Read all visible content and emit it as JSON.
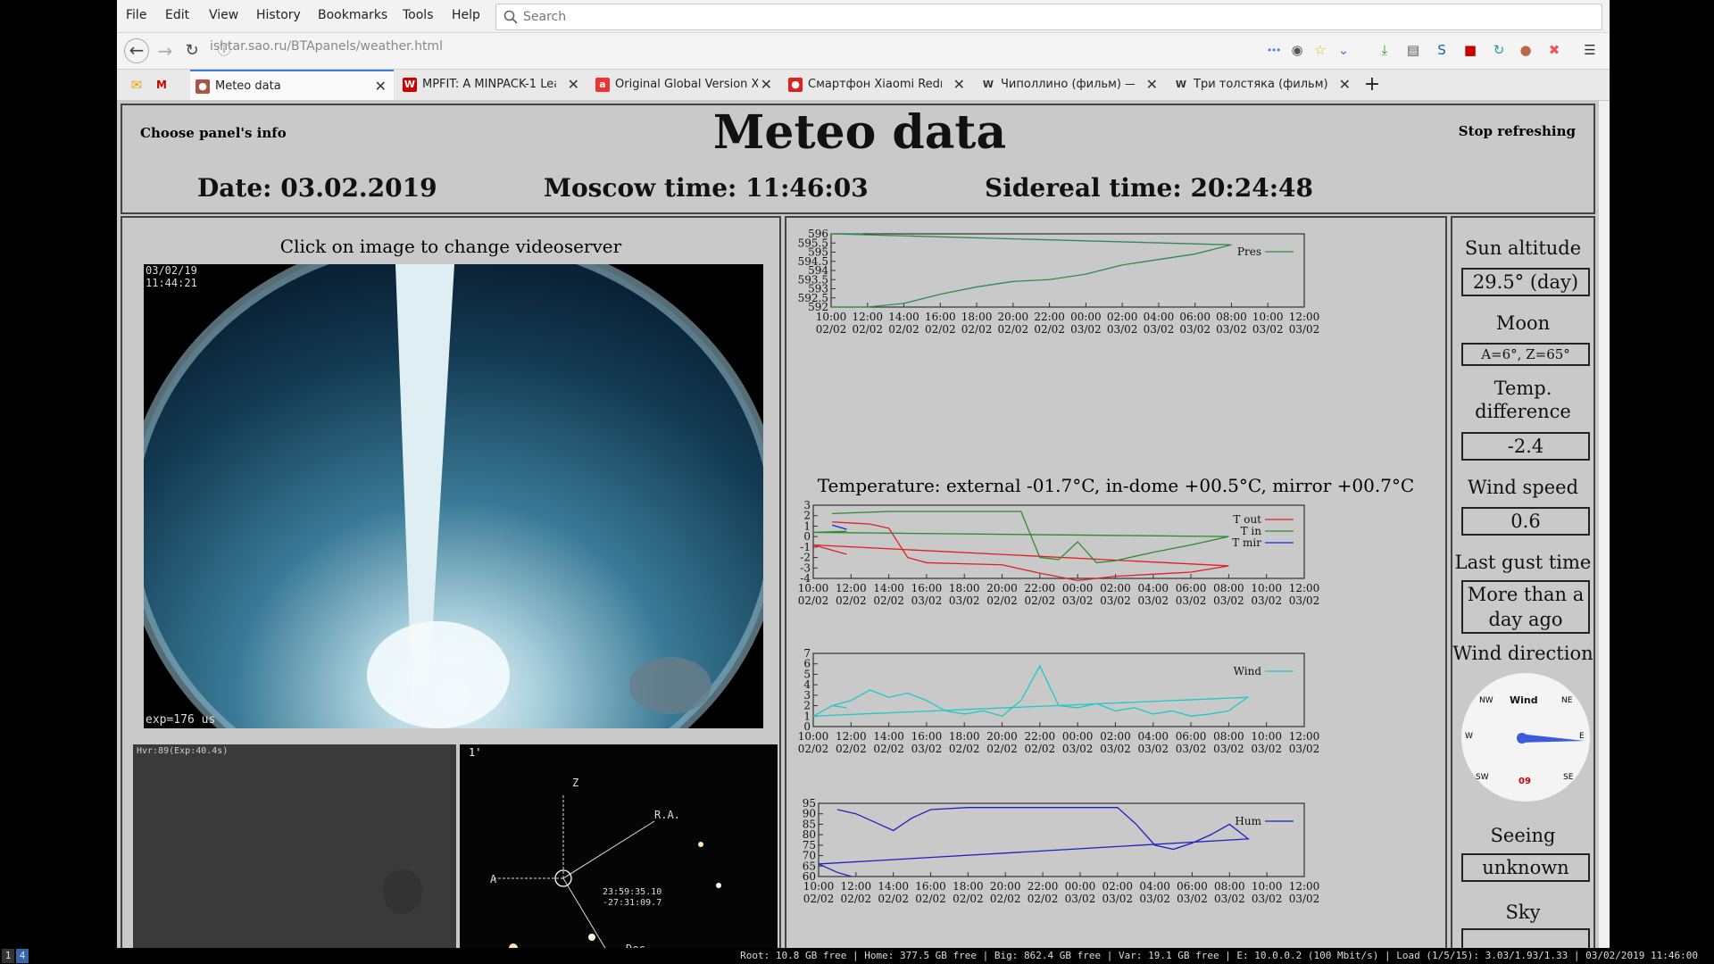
{
  "menu": {
    "items": [
      "File",
      "Edit",
      "View",
      "History",
      "Bookmarks",
      "Tools",
      "Help"
    ],
    "search_placeholder": "Search"
  },
  "nav": {
    "url": "ishtar.sao.ru/BTApanels/weather.html"
  },
  "tabs": [
    {
      "label": "Meteo data",
      "active": true,
      "fav_color": "#a54"
    },
    {
      "label": "MPFIT: A MINPACK-1 Lea",
      "fav_color": "#c00"
    },
    {
      "label": "Original Global Version X",
      "fav_color": "#e33"
    },
    {
      "label": "Смартфон Xiaomi Redm",
      "fav_color": "#d22"
    },
    {
      "label": "Чиполлино (фильм) —",
      "fav_color": "#555"
    },
    {
      "label": "Три толстяка (фильм) .",
      "fav_color": "#555"
    }
  ],
  "page": {
    "title": "Meteo data",
    "choose_panels": "Choose panel's info",
    "stop_refreshing": "Stop refreshing",
    "date": "Date: 03.02.2019",
    "moscow_time": "Moscow time: 11:46:03",
    "sidereal_time": "Sidereal time: 20:24:48",
    "click_hint": "Click on image to change videoserver",
    "cam_date": "03/02/19",
    "cam_time": "11:44:21",
    "cam_exposure": "exp=176 us",
    "cam2_label": "Hvr:89(Exp:40.4s)",
    "cam3_label": "1'",
    "cam3_coord1": "23:59:35.10",
    "cam3_coord2": "-27:31:09.7",
    "cam3_ra": "R.A.",
    "cam3_dec": "Dec",
    "cam3_z": "Z",
    "cam3_a": "A"
  },
  "temp_heading": "Temperature: external -01.7°C, in-dome +00.5°C, mirror +00.7°C",
  "right_panel": {
    "sun_label": "Sun altitude",
    "sun_value": "29.5° (day)",
    "moon_label": "Moon",
    "moon_value": "A=6°, Z=65°",
    "tdiff_label": "Temp. difference",
    "tdiff_value": "-2.4",
    "wind_label": "Wind speed",
    "wind_value": "0.6",
    "gust_label": "Last gust time",
    "gust_value": "More than a day ago",
    "dir_label": "Wind direction",
    "compass": {
      "center": "Wind",
      "nw": "NW",
      "ne": "NE",
      "w": "W",
      "e": "E",
      "sw": "SW",
      "se": "SE",
      "reading": "09"
    },
    "seeing_label": "Seeing",
    "seeing_value": "unknown",
    "sky_label": "Sky"
  },
  "chart_data": [
    {
      "type": "line",
      "title": "",
      "series": [
        {
          "name": "Pres",
          "color": "#2e8b57",
          "x": [
            "10:00",
            "12:00",
            "14:00",
            "16:00",
            "18:00",
            "20:00",
            "22:00",
            "00:00",
            "02:00",
            "04:00",
            "06:00",
            "08:00",
            "10:00",
            "11:46"
          ],
          "values": [
            592,
            592,
            592.2,
            592.7,
            593.1,
            593.4,
            593.5,
            593.8,
            594.3,
            594.6,
            594.9,
            595.4,
            596,
            596
          ]
        }
      ],
      "ylim": [
        592,
        596
      ],
      "yticks": [
        "592",
        "592.5",
        "593",
        "593.5",
        "594",
        "594.5",
        "595",
        "595.5",
        "596"
      ],
      "xticks": [
        "10:00",
        "12:00",
        "14:00",
        "16:00",
        "18:00",
        "20:00",
        "22:00",
        "00:00",
        "02:00",
        "04:00",
        "06:00",
        "08:00",
        "10:00",
        "12:00"
      ],
      "xdates": [
        "02/02",
        "02/02",
        "02/02",
        "02/02",
        "02/02",
        "02/02",
        "02/02",
        "03/02",
        "03/02",
        "03/02",
        "03/02",
        "03/02",
        "03/02",
        "03/02"
      ]
    },
    {
      "type": "line",
      "title": "",
      "series": [
        {
          "name": "T out",
          "color": "#e02020",
          "x": [
            "11:00",
            "12:00",
            "13:00",
            "14:00",
            "15:00",
            "16:00",
            "18:00",
            "20:00",
            "22:00",
            "00:00",
            "02:00",
            "04:00",
            "06:00",
            "08:00",
            "10:00",
            "11:46"
          ],
          "values": [
            1.4,
            1.3,
            1.2,
            0.8,
            -2.0,
            -2.5,
            -2.6,
            -2.7,
            -3.5,
            -4.2,
            -3.8,
            -3.6,
            -3.4,
            -2.8,
            -0.8,
            -1.7
          ]
        },
        {
          "name": "T in",
          "color": "#2e8b2e",
          "x": [
            "11:00",
            "14:00",
            "18:00",
            "21:00",
            "22:00",
            "23:00",
            "00:00",
            "01:00",
            "02:00",
            "04:00",
            "06:00",
            "08:00",
            "10:00",
            "11:46"
          ],
          "values": [
            2.2,
            2.4,
            2.4,
            2.4,
            -2.0,
            -2.2,
            -0.5,
            -2.5,
            -2.3,
            -1.5,
            -0.8,
            0.0,
            0.4,
            0.5
          ]
        },
        {
          "name": "T mir",
          "color": "#2020e0",
          "x": [
            "11:00",
            "11:46"
          ],
          "values": [
            1.1,
            0.7
          ]
        }
      ],
      "ylim": [
        -4,
        3
      ],
      "yticks": [
        "-4",
        "-3",
        "-2",
        "-1",
        "0",
        "1",
        "2",
        "3"
      ],
      "xticks": [
        "10:00",
        "12:00",
        "14:00",
        "16:00",
        "18:00",
        "20:00",
        "22:00",
        "00:00",
        "02:00",
        "04:00",
        "06:00",
        "08:00",
        "10:00",
        "12:00"
      ],
      "xdates": [
        "02/02",
        "02/02",
        "02/02",
        "03/02",
        "03/02",
        "02/02",
        "02/02",
        "03/02",
        "03/02",
        "03/02",
        "03/02",
        "03/02",
        "03/02",
        "03/02"
      ]
    },
    {
      "type": "line",
      "title": "",
      "series": [
        {
          "name": "Wind",
          "color": "#20c8c8",
          "x": [
            "11:00",
            "12:00",
            "13:00",
            "14:00",
            "15:00",
            "16:00",
            "17:00",
            "18:00",
            "19:00",
            "20:00",
            "21:00",
            "22:00",
            "23:00",
            "00:00",
            "01:00",
            "02:00",
            "03:00",
            "04:00",
            "05:00",
            "06:00",
            "07:00",
            "08:00",
            "09:00",
            "10:00",
            "11:00",
            "11:46"
          ],
          "values": [
            2.0,
            2.5,
            3.5,
            2.8,
            3.2,
            2.5,
            1.5,
            1.2,
            1.5,
            1.0,
            2.5,
            5.8,
            2.0,
            1.8,
            2.2,
            1.5,
            1.8,
            1.2,
            1.5,
            1.0,
            1.2,
            1.5,
            2.8,
            1.0,
            2.0,
            1.8
          ]
        }
      ],
      "ylim": [
        0,
        7
      ],
      "yticks": [
        "0",
        "1",
        "2",
        "3",
        "4",
        "5",
        "6",
        "7"
      ],
      "xticks": [
        "10:00",
        "12:00",
        "14:00",
        "16:00",
        "18:00",
        "20:00",
        "22:00",
        "00:00",
        "02:00",
        "04:00",
        "06:00",
        "08:00",
        "10:00",
        "12:00"
      ],
      "xdates": [
        "02/02",
        "02/02",
        "02/02",
        "03/02",
        "02/02",
        "02/02",
        "02/02",
        "03/02",
        "03/02",
        "03/02",
        "03/02",
        "03/02",
        "03/02",
        "03/02"
      ]
    },
    {
      "type": "line",
      "title": "",
      "series": [
        {
          "name": "Hum",
          "color": "#2020c0",
          "x": [
            "11:00",
            "12:00",
            "13:00",
            "14:00",
            "15:00",
            "16:00",
            "18:00",
            "20:00",
            "22:00",
            "00:00",
            "02:00",
            "03:00",
            "04:00",
            "05:00",
            "06:00",
            "07:00",
            "08:00",
            "09:00",
            "10:00",
            "11:00",
            "11:46"
          ],
          "values": [
            92,
            90,
            86,
            82,
            88,
            92,
            93,
            93,
            93,
            93,
            93,
            85,
            75,
            73,
            76,
            80,
            85,
            78,
            66,
            62,
            60
          ]
        }
      ],
      "ylim": [
        60,
        95
      ],
      "yticks": [
        "60",
        "65",
        "70",
        "75",
        "80",
        "85",
        "90",
        "95"
      ],
      "xticks": [
        "10:00",
        "12:00",
        "14:00",
        "16:00",
        "18:00",
        "20:00",
        "22:00",
        "00:00",
        "02:00",
        "04:00",
        "06:00",
        "08:00",
        "10:00",
        "12:00"
      ],
      "xdates": [
        "02/02",
        "02/02",
        "02/02",
        "02/02",
        "02/02",
        "02/02",
        "02/02",
        "03/02",
        "03/02",
        "03/02",
        "03/02",
        "03/02",
        "03/02",
        "03/02"
      ]
    }
  ],
  "taskbar": {
    "ws1": "1",
    "ws2": "4",
    "status": "Root: 10.8 GB free | Home: 377.5 GB free | Big: 862.4 GB free | Var: 19.1 GB free | E: 10.0.0.2 (100 Mbit/s) | Load (1/5/15): 3.03/1.93/1.33 | 03/02/2019 11:46:00"
  }
}
